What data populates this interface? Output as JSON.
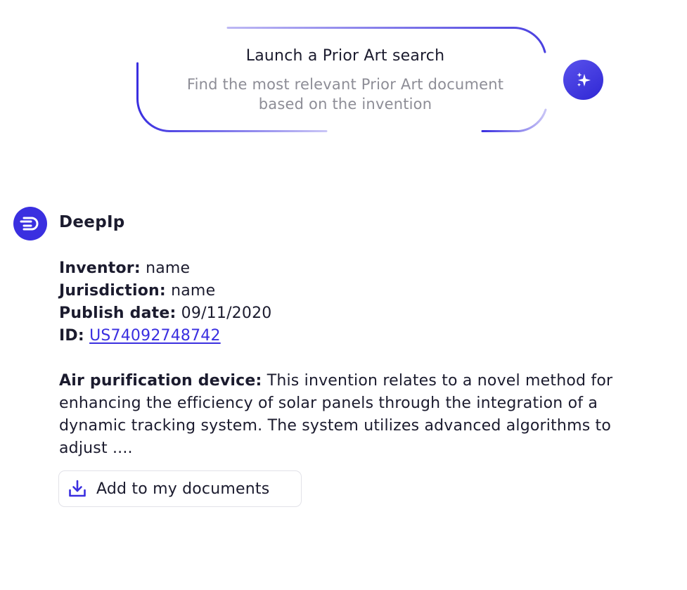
{
  "prompt_card": {
    "title": "Launch a Prior Art search",
    "subtitle_line1": "Find the most relevant Prior Art document",
    "subtitle_line2": "based on the invention",
    "action_icon": "sparkles-icon"
  },
  "result": {
    "sender": "DeepIp",
    "avatar_icon": "deepip-logo-icon",
    "meta": {
      "inventor_label": "Inventor:",
      "inventor_value": "name",
      "jurisdiction_label": "Jurisdiction:",
      "jurisdiction_value": "name",
      "publish_date_label": "Publish date:",
      "publish_date_value": "09/11/2020",
      "id_label": "ID:",
      "id_value": "US74092748742"
    },
    "abstract_title": "Air purification device:",
    "abstract_text": "This invention relates to a novel method for enhancing the efficiency of solar panels through the integration of a dynamic tracking system. The system utilizes advanced algorithms to adjust ....",
    "add_button": {
      "label": "Add to my documents",
      "icon": "download-icon"
    }
  },
  "colors": {
    "accent": "#3a2fe0",
    "text": "#1b1b2e",
    "muted": "#8d8d96",
    "border": "#e2e2e8"
  }
}
